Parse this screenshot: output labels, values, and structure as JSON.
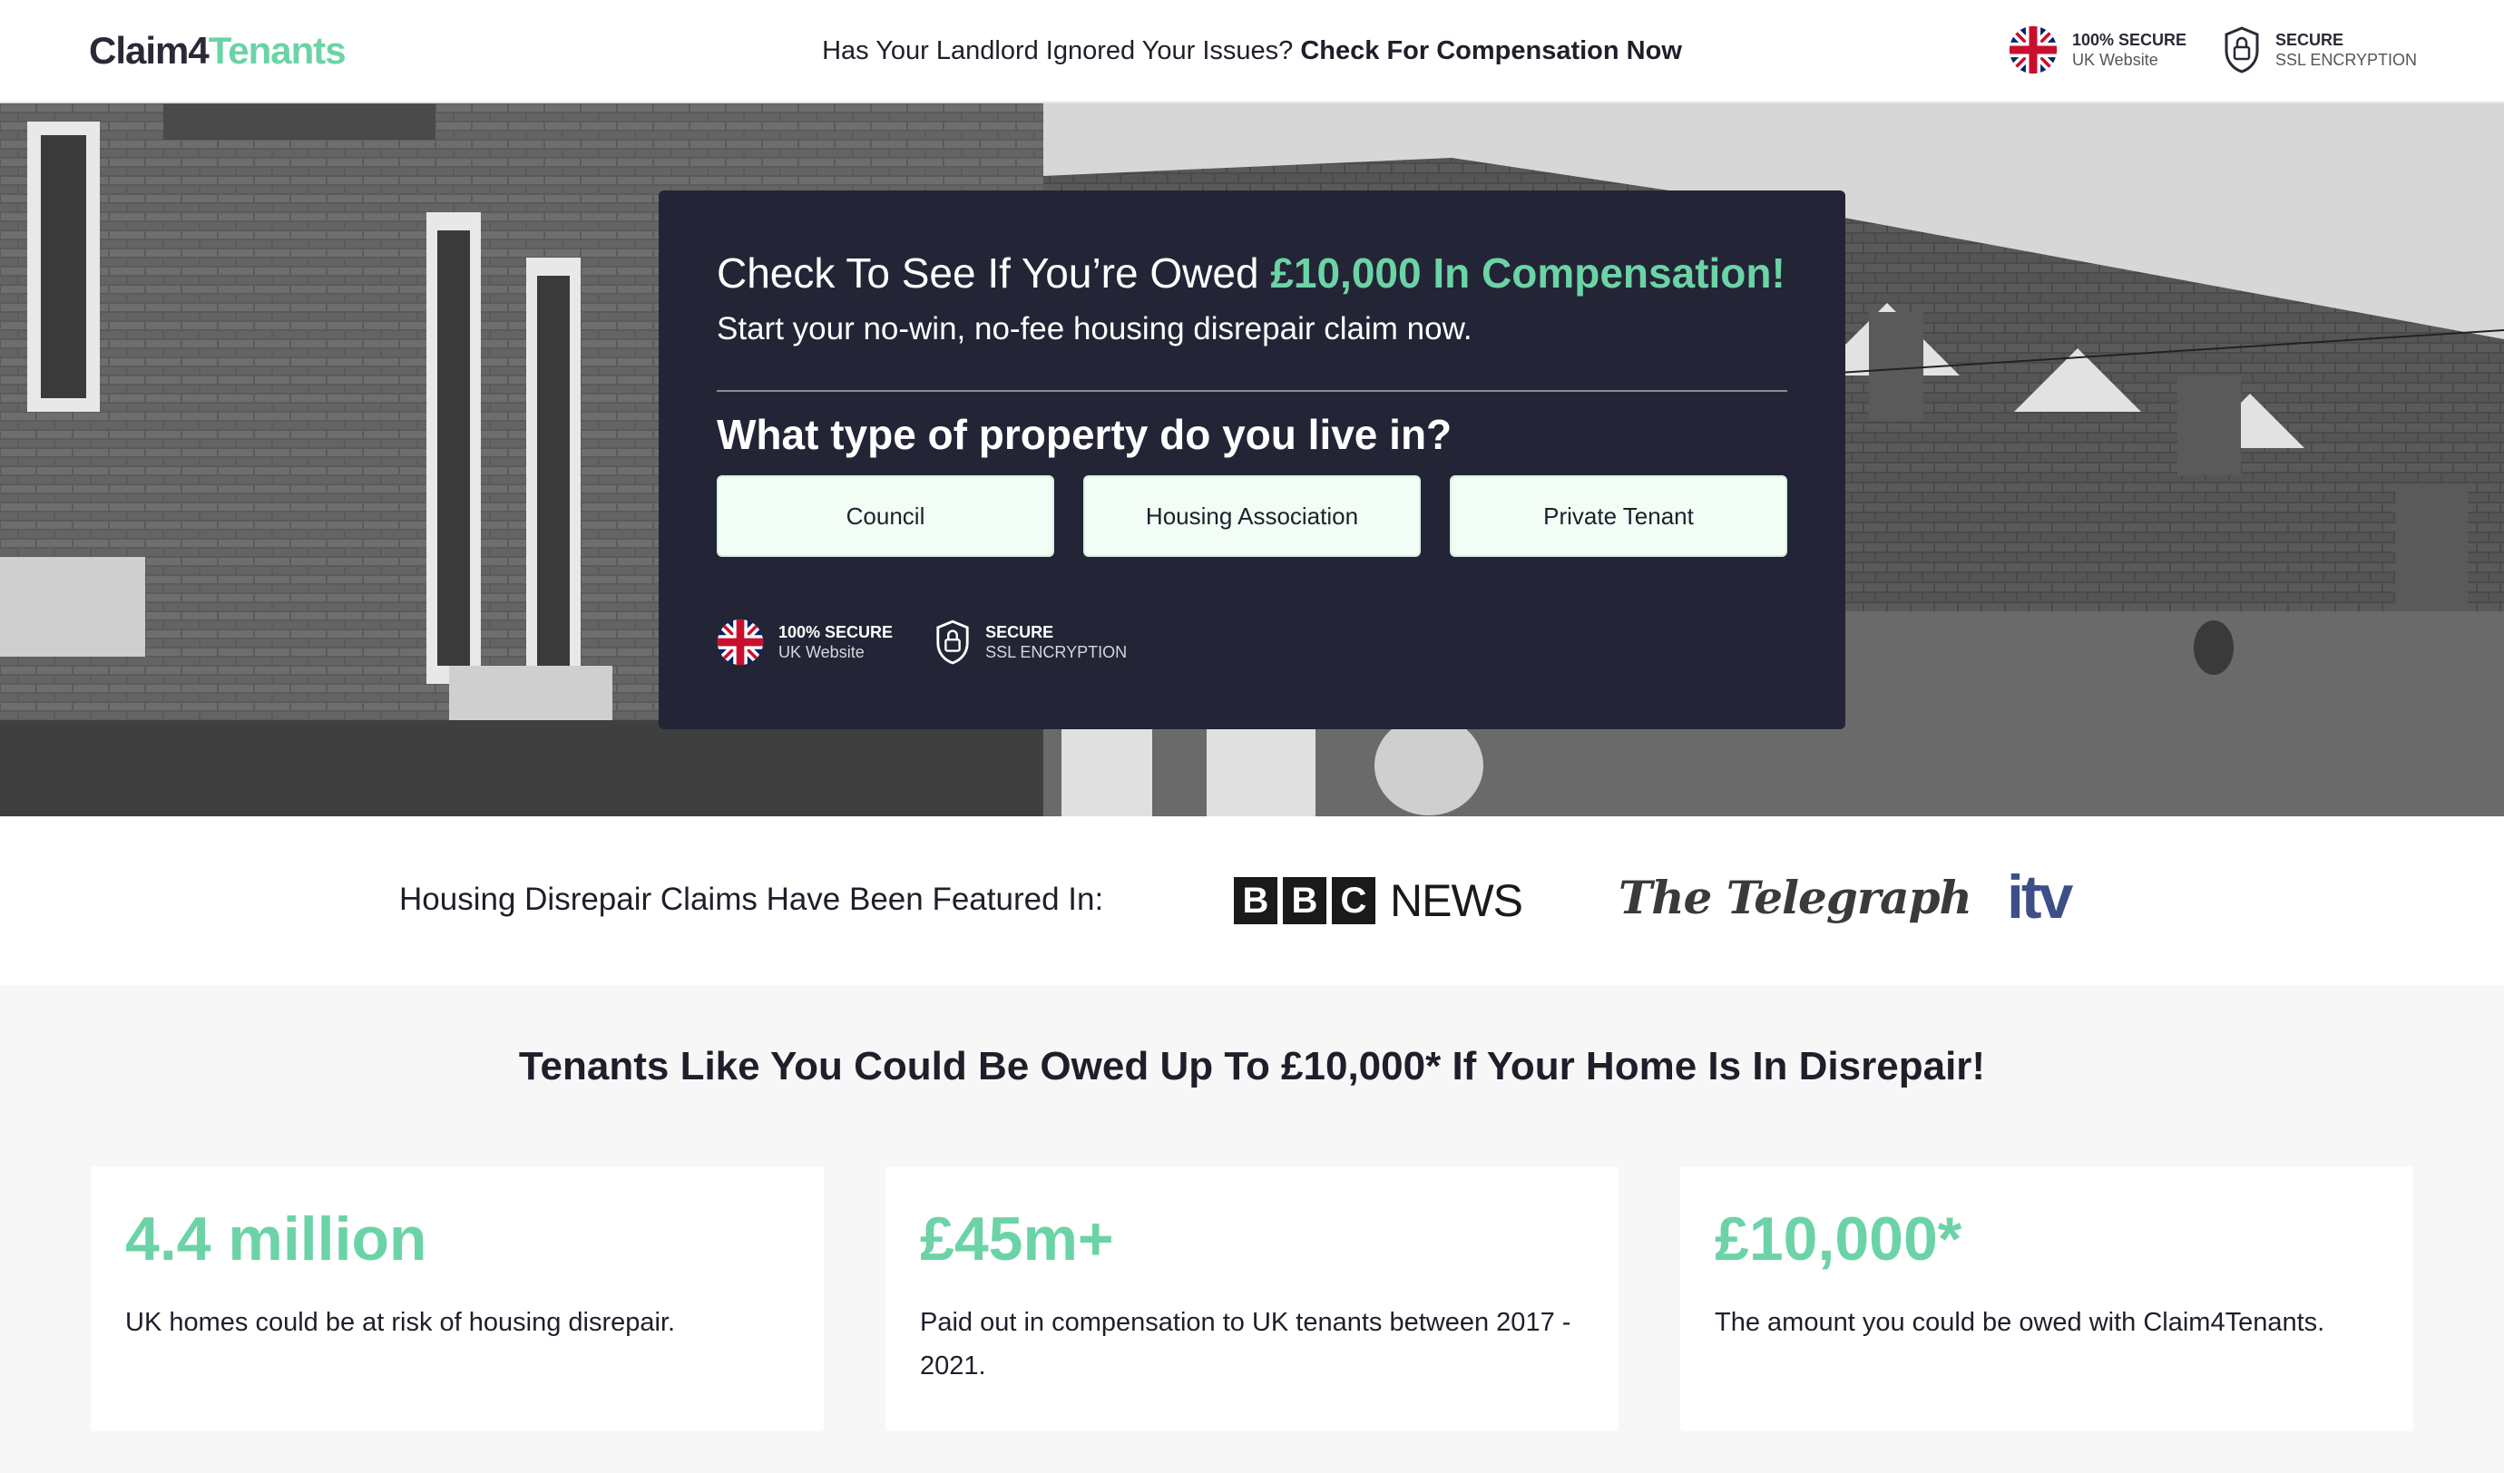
{
  "header": {
    "logo_part1": "Claim4",
    "logo_part2": "Tenants",
    "tagline_plain": "Has Your Landlord Ignored Your Issues?",
    "tagline_bold": "Check For Compensation Now",
    "badges": [
      {
        "title": "100% SECURE",
        "subtitle": "UK Website",
        "icon": "uk-flag-icon"
      },
      {
        "title": "SECURE",
        "subtitle": "SSL ENCRYPTION",
        "icon": "shield-lock-icon"
      }
    ]
  },
  "hero": {
    "headline_plain": "Check To See If You’re Owed",
    "headline_highlight": "£10,000 In Compensation!",
    "subheadline": "Start your no-win, no-fee housing disrepair claim now.",
    "question": "What type of property do you live in?",
    "options": [
      "Council",
      "Housing Association",
      "Private Tenant"
    ],
    "badges": [
      {
        "title": "100% SECURE",
        "subtitle": "UK Website",
        "icon": "uk-flag-icon"
      },
      {
        "title": "SECURE",
        "subtitle": "SSL ENCRYPTION",
        "icon": "shield-lock-icon"
      }
    ]
  },
  "featured": {
    "label": "Housing Disrepair Claims Have Been Featured In:",
    "bbc_letters": [
      "B",
      "B",
      "C"
    ],
    "bbc_news": "NEWS",
    "telegraph": "The Telegraph",
    "itv": "itv"
  },
  "stats": {
    "title": "Tenants Like You Could Be Owed Up To £10,000* If Your Home Is In Disrepair!",
    "items": [
      {
        "value": "4.4 million",
        "description": "UK homes could be at risk of housing disrepair."
      },
      {
        "value": "£45m+",
        "description": "Paid out in compensation to UK tenants between 2017 - 2021."
      },
      {
        "value": "£10,000*",
        "description": "The amount you could be owed with Claim4Tenants."
      }
    ]
  },
  "colors": {
    "accent": "#6cd3a6",
    "card_bg": "#232536",
    "option_bg": "#f1fdf5",
    "itv_blue": "#3e4f87"
  }
}
